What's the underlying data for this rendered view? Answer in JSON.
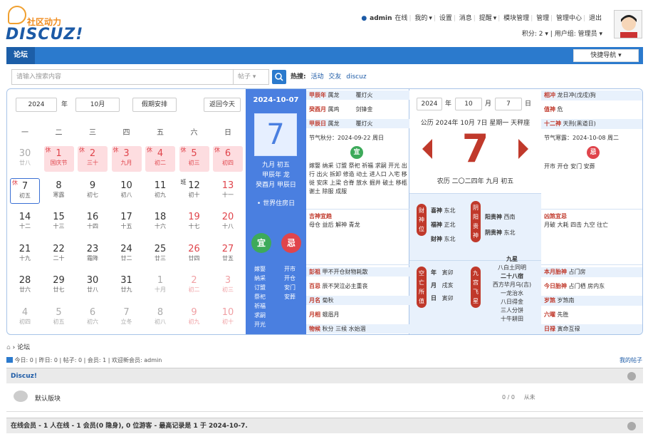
{
  "header": {
    "logo_sub": "社区动力",
    "logo_main": "DISCUZ!",
    "user": "admin",
    "status": "在线",
    "my": "我的",
    "settings": "设置",
    "messages": "消息",
    "remind": "提醒",
    "modules": "模块管理",
    "manage": "管理",
    "admin_center": "管理中心",
    "logout": "退出",
    "points": "积分: 2",
    "usergroup": "用户组: 管理员"
  },
  "nav": {
    "tab": "论坛",
    "quick": "快捷导航"
  },
  "search": {
    "placeholder": "请输入搜索内容",
    "scope": "帖子",
    "hot_label": "热搜:",
    "hot": [
      "活动",
      "交友",
      "discuz"
    ]
  },
  "calendar": {
    "year": "2024",
    "year_unit": "年",
    "month": "10月",
    "holiday_btn": "假期安排",
    "today_btn": "返回今天",
    "weekdays": [
      "一",
      "二",
      "三",
      "四",
      "五",
      "六",
      "日"
    ],
    "days": [
      {
        "n": "30",
        "l": "廿八",
        "t": "",
        "c": "fade"
      },
      {
        "n": "1",
        "l": "国庆节",
        "t": "休",
        "c": "hol"
      },
      {
        "n": "2",
        "l": "三十",
        "t": "休",
        "c": "hol"
      },
      {
        "n": "3",
        "l": "九月",
        "t": "休",
        "c": "hol"
      },
      {
        "n": "4",
        "l": "初二",
        "t": "休",
        "c": "hol"
      },
      {
        "n": "5",
        "l": "初三",
        "t": "休",
        "c": "hol"
      },
      {
        "n": "6",
        "l": "初四",
        "t": "休",
        "c": "hol"
      },
      {
        "n": "7",
        "l": "初五",
        "t": "休",
        "c": "today"
      },
      {
        "n": "8",
        "l": "寒露",
        "t": "",
        "c": ""
      },
      {
        "n": "9",
        "l": "初七",
        "t": "",
        "c": ""
      },
      {
        "n": "10",
        "l": "初八",
        "t": "",
        "c": ""
      },
      {
        "n": "11",
        "l": "初九",
        "t": "",
        "c": ""
      },
      {
        "n": "12",
        "l": "初十",
        "t": "班",
        "c": "work"
      },
      {
        "n": "13",
        "l": "十一",
        "t": "",
        "c": "red"
      },
      {
        "n": "14",
        "l": "十二",
        "t": "",
        "c": ""
      },
      {
        "n": "15",
        "l": "十三",
        "t": "",
        "c": ""
      },
      {
        "n": "16",
        "l": "十四",
        "t": "",
        "c": ""
      },
      {
        "n": "17",
        "l": "十五",
        "t": "",
        "c": ""
      },
      {
        "n": "18",
        "l": "十六",
        "t": "",
        "c": ""
      },
      {
        "n": "19",
        "l": "十七",
        "t": "",
        "c": "red"
      },
      {
        "n": "20",
        "l": "十八",
        "t": "",
        "c": "red"
      },
      {
        "n": "21",
        "l": "十九",
        "t": "",
        "c": ""
      },
      {
        "n": "22",
        "l": "二十",
        "t": "",
        "c": ""
      },
      {
        "n": "23",
        "l": "霜降",
        "t": "",
        "c": ""
      },
      {
        "n": "24",
        "l": "廿二",
        "t": "",
        "c": ""
      },
      {
        "n": "25",
        "l": "廿三",
        "t": "",
        "c": ""
      },
      {
        "n": "26",
        "l": "廿四",
        "t": "",
        "c": "red"
      },
      {
        "n": "27",
        "l": "廿五",
        "t": "",
        "c": "red"
      },
      {
        "n": "28",
        "l": "廿六",
        "t": "",
        "c": ""
      },
      {
        "n": "29",
        "l": "廿七",
        "t": "",
        "c": ""
      },
      {
        "n": "30",
        "l": "廿八",
        "t": "",
        "c": ""
      },
      {
        "n": "31",
        "l": "廿九",
        "t": "",
        "c": ""
      },
      {
        "n": "1",
        "l": "十月",
        "t": "",
        "c": "fade"
      },
      {
        "n": "2",
        "l": "初二",
        "t": "",
        "c": "fade red"
      },
      {
        "n": "3",
        "l": "初三",
        "t": "",
        "c": "fade red"
      },
      {
        "n": "4",
        "l": "初四",
        "t": "",
        "c": "fade"
      },
      {
        "n": "5",
        "l": "初五",
        "t": "",
        "c": "fade"
      },
      {
        "n": "6",
        "l": "初六",
        "t": "",
        "c": "fade"
      },
      {
        "n": "7",
        "l": "立冬",
        "t": "",
        "c": "fade"
      },
      {
        "n": "8",
        "l": "初八",
        "t": "",
        "c": "fade"
      },
      {
        "n": "9",
        "l": "初九",
        "t": "",
        "c": "fade red"
      },
      {
        "n": "10",
        "l": "初十",
        "t": "",
        "c": "fade red"
      }
    ]
  },
  "today": {
    "date": "2024-10-07",
    "day": "7",
    "lunar": "九月 初五",
    "year_gz": "甲辰年 龙",
    "month_gz": "癸酉月 甲辰日",
    "world": "• 世界住房日",
    "yi": "宜",
    "ji": "忌",
    "yi_list": [
      "嫁娶",
      "纳采",
      "订盟",
      "祭祀",
      "祈福",
      "求嗣",
      "开光"
    ],
    "ji_list": [
      "开市",
      "开仓",
      "安门",
      "安葬"
    ]
  },
  "mid": {
    "r1": {
      "k": "甲辰年",
      "a": "属龙",
      "b": "覆灯火"
    },
    "r2": {
      "k": "癸酉月",
      "a": "属鸡",
      "b": "剑锋金"
    },
    "r3": {
      "k": "甲辰日",
      "a": "属龙",
      "b": "覆灯火"
    },
    "jieqi": "节气秋分：2024-09-22 周日",
    "yi": "宜",
    "yi_text": "嫁娶 纳采 订盟 祭祀 祈福 求嗣 开光 出行 出火 拆卸 修造 动土 进人口 入宅 移徙 安床 上梁 合脊 放水 掘井 破土 移柩 谢土 除服 成服",
    "jishen_label": "吉神宜趋",
    "jishen": "母仓 益后 解神 青龙",
    "pengzu_label": "彭祖",
    "pengzu": "甲不开仓财物耗散",
    "baiji_label": "百忌",
    "baiji": "辰不哭泣必主重丧",
    "yuexiang_label": "月名",
    "yuexiang": "菊秋",
    "yuexiang2_label": "月相",
    "yuexiang2": "蛾眉月",
    "wuhou_label": "物候",
    "wuhou": "秋分 三候 水始涸"
  },
  "center": {
    "year": "2024",
    "month": "10",
    "day": "7",
    "y": "年",
    "m": "月",
    "d": "日",
    "gongli": "公历 2024年 10月 7日 星期一 天秤座",
    "big": "7",
    "nongli": "农历 二〇二四年 九月 初五",
    "shen_label": "财神位",
    "yinyang_label": "阴阳贵神",
    "xi": "喜神",
    "xi_v": "东北",
    "fu": "福神",
    "fu_v": "正北",
    "cai": "财神",
    "cai_v": "东北",
    "yang": "阳贵神",
    "yang_v": "西南",
    "yin": "阴贵神",
    "yin_v": "东北",
    "kong_label": "空亡所值",
    "jiu_label": "九宫飞星",
    "nian": "年",
    "nian_v": "寅卯",
    "yue": "月",
    "yue_v": "戌亥",
    "ri": "日",
    "ri_v": "寅卯",
    "jiuxing": "九星",
    "jx1": "八白土同明",
    "jx2": "二十八宿",
    "jx3": "西方毕月乌(吉)",
    "jx4": "一龙治水",
    "jx5": "八日得金",
    "jx6": "三人分饼",
    "jx7": "十牛耕田"
  },
  "right": {
    "chong": "相冲",
    "chong_v": "龙日冲(戊戌)狗",
    "sha": "值神",
    "sha_v": "危",
    "jianxing": "十二神",
    "jianxing_v": "天刑(黑道日)",
    "jieqi": "节气寒露：2024-10-08 周二",
    "ji": "忌",
    "ji_text": "开市 开仓 安门 安葬",
    "xiongsha_label": "凶煞宜忌",
    "xiongsha": "月破 大耗 四击 九空 往亡",
    "tai_label": "本月胎神",
    "tai": "占门房",
    "tai2_label": "今日胎神",
    "tai2": "占门栖 房内东",
    "xingxiu_label": "岁煞",
    "xingxiu": "岁煞南",
    "liuyao_label": "六曜",
    "liuyao": "先胜",
    "rilu_label": "日禄",
    "rilu": "寅命互禄"
  },
  "breadcrumb": {
    "home": "⌂",
    "sep": "›",
    "cur": "论坛"
  },
  "stats": {
    "text": "今日: 0 | 昨日: 0 | 帖子: 0 | 会员: 1 | 欢迎新会员: admin",
    "mypost": "我的帖子"
  },
  "forum": {
    "section": "Discuz!",
    "name": "默认版块",
    "count": "0 / 0",
    "last": "从未"
  },
  "online": {
    "text": "在线会员 - 1 人在线 - 1 会员(0 隐身), 0 位游客 - 最高记录是 1 于 2024-10-7."
  }
}
